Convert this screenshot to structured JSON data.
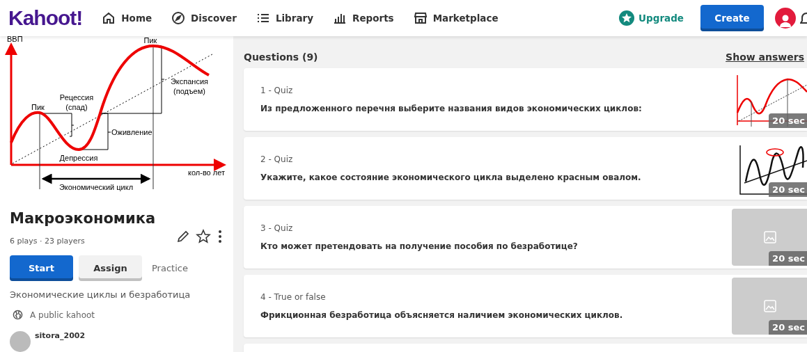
{
  "header": {
    "logo": "Kahoot!",
    "nav": [
      {
        "label": "Home",
        "kind": "home"
      },
      {
        "label": "Discover",
        "kind": "compass"
      },
      {
        "label": "Library",
        "kind": "list"
      },
      {
        "label": "Reports",
        "kind": "bars"
      },
      {
        "label": "Marketplace",
        "kind": "store"
      }
    ],
    "upgrade": "Upgrade",
    "create": "Create"
  },
  "cover": {
    "y_axis": "ВВП",
    "x_axis": "кол-во лет",
    "peak_left": "Пик",
    "peak_right": "Пик",
    "recession": "Рецессия",
    "recession_note": "(спад)",
    "recovery": "Оживление",
    "depression": "Депрессия",
    "expansion": "Экспансия",
    "expansion_note": "(подъем)",
    "cycle": "Экономический цикл"
  },
  "kahoot": {
    "title": "Макроэкономика",
    "stats": "6 plays · 23 players",
    "start": "Start",
    "assign": "Assign",
    "practice": "Practice",
    "description": "Экономические циклы и безработица",
    "visibility": "A public kahoot",
    "author": "sitora_2002"
  },
  "questions": {
    "heading": "Questions (9)",
    "show_answers": "Show answers",
    "items": [
      {
        "type": "1 - Quiz",
        "text": "Из предложенного перечня выберите названия видов экономических циклов:",
        "kind": "cycle",
        "time": "20 sec"
      },
      {
        "type": "2 - Quiz",
        "text": "Укажите, какое состояние экономического цикла выделено красным овалом.",
        "kind": "wave",
        "time": "20 sec"
      },
      {
        "type": "3 - Quiz",
        "text": "Кто может претендовать на получение пособия по безработице?",
        "kind": "empty",
        "time": "20 sec"
      },
      {
        "type": "4 - True or false",
        "text": "Фрикционная безработица объясняется наличием экономических циклов.",
        "kind": "empty",
        "time": "20 sec"
      }
    ]
  }
}
